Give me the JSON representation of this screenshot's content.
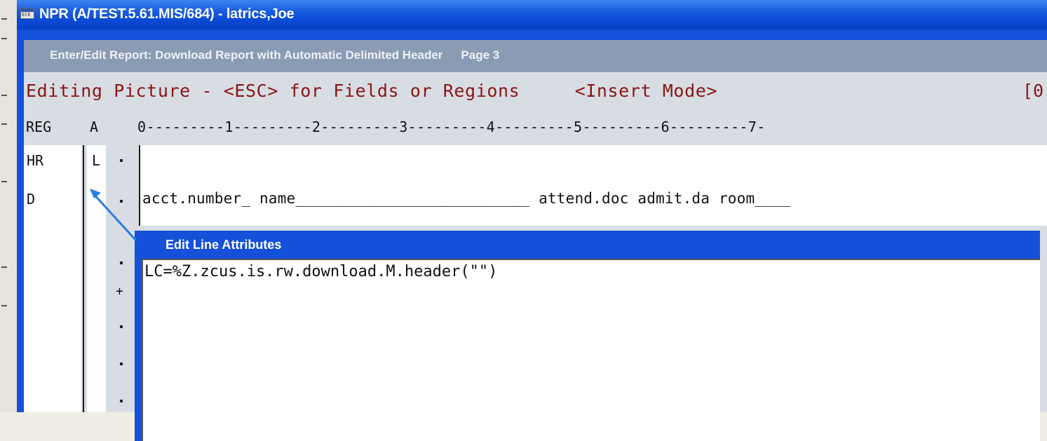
{
  "window": {
    "title": "NPR (A/TEST.5.61.MIS/684) - latrics,Joe",
    "icon": "terminal-app-icon",
    "icon_text": "ECE"
  },
  "screen": {
    "subtitle": "Enter/Edit Report: Download Report with Automatic Delimited Header",
    "page": "Page 3",
    "mode_line": "Editing Picture - <ESC> for Fields or Regions     <Insert Mode>",
    "mode_line_right": "[0",
    "columns_header": {
      "reg": "REG",
      "attr": "A",
      "ruler": "0---------1---------2---------3---------4---------5---------6---------7-"
    },
    "rows": [
      {
        "reg": "HR",
        "attr": "L",
        "marker": "·",
        "content": ""
      },
      {
        "reg": "D",
        "attr": "",
        "marker": "·",
        "content": "acct.number_ name__________________________ attend.doc admit.da room____"
      },
      {
        "reg": "",
        "attr": "",
        "marker": "·",
        "content": ""
      },
      {
        "reg": "",
        "attr": "",
        "marker": "+",
        "content": ""
      },
      {
        "reg": "",
        "attr": "",
        "marker": "·",
        "content": ""
      },
      {
        "reg": "",
        "attr": "",
        "marker": "·",
        "content": ""
      },
      {
        "reg": "",
        "attr": "",
        "marker": "·",
        "content": ""
      }
    ]
  },
  "popup": {
    "title": "Edit Line Attributes",
    "value": "LC=%Z.zcus.is.rw.download.M.header(\"\")"
  },
  "colors": {
    "titlebar": "#0a49d4",
    "frame": "#1550d8",
    "subtitle_bar": "#8c9bb4",
    "mode_text": "#8a1515",
    "arrow": "#2a7de1"
  }
}
